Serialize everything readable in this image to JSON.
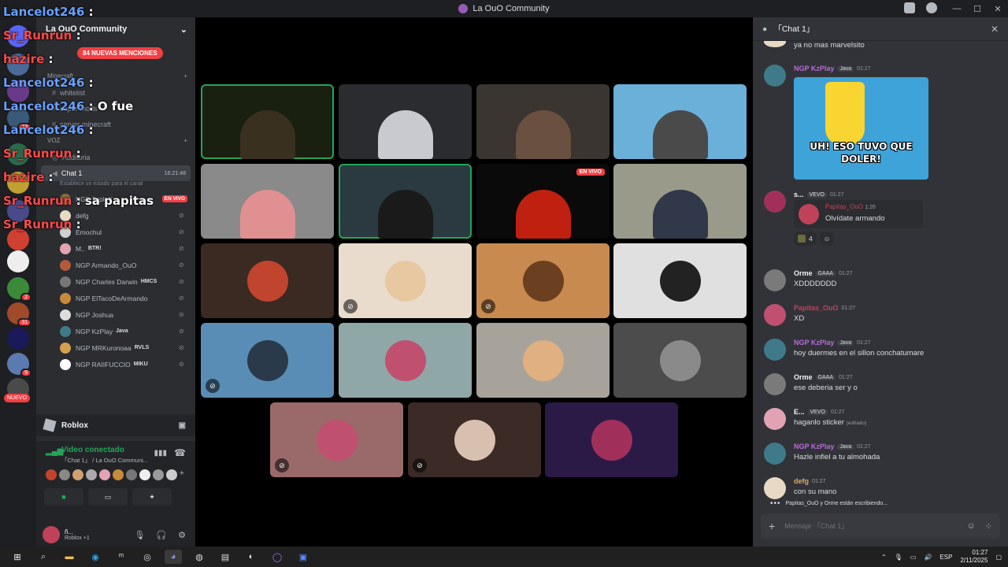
{
  "window": {
    "title": "La OuO Community",
    "minimize": "—",
    "maximize": "☐",
    "close": "✕"
  },
  "rail": {
    "nuevo_label": "NUEVO",
    "badges": [
      "73",
      "2",
      "31",
      "9"
    ]
  },
  "sidebar": {
    "guild_name": "La OuO Community",
    "mentions_pill": "84 NUEVAS MENCIONES",
    "categories": [
      "Minecraft",
      "VOZ"
    ],
    "channels": [
      "whitelist",
      "super-mods",
      "server-minecraft",
      "Auditoria",
      "Chat 1"
    ],
    "voice_status": "Establece un estado para el canal",
    "voice_timer": "16:21:48",
    "members": [
      {
        "name": "NGP TripleX",
        "tag": "",
        "live": "EN VIVO",
        "color": "#8a6d3b"
      },
      {
        "name": "defg",
        "tag": "",
        "color": "#e7d9c4"
      },
      {
        "name": "Emochul",
        "tag": "",
        "color": "#cfcfcf"
      },
      {
        "name": "M..",
        "tag": "BTR!",
        "color": "#e1a3b3"
      },
      {
        "name": "NGP Armando_OuO",
        "tag": "",
        "color": "#b25a3a"
      },
      {
        "name": "NGP Charles Darwin",
        "tag": "HMCS",
        "color": "#777777"
      },
      {
        "name": "NGP ElTacoDeArmando",
        "tag": "",
        "color": "#c68a3a"
      },
      {
        "name": "NGP Joshua",
        "tag": "",
        "color": "#dddddd"
      },
      {
        "name": "NGP KzPlay",
        "tag": "Java",
        "color": "#3e7a8a"
      },
      {
        "name": "NGP MRKuronoaa",
        "tag": "RVLS",
        "color": "#d4a050"
      },
      {
        "name": "NGP RAIIFUCCIO",
        "tag": "MIKU",
        "color": "#ffffff"
      }
    ],
    "roblox_label": "Roblox",
    "voice_panel": {
      "title": "Video conectado",
      "subtitle": "「Chat 1」 / La OuO Communi..."
    },
    "user": {
      "name": "ñ...",
      "status": "Roblox +1"
    }
  },
  "overlay": [
    {
      "name": "Lancelot246",
      "text": ":",
      "color": "#6aa0ff"
    },
    {
      "name": "Sr_Runrun",
      "text": ":",
      "color": "#ff4a4a"
    },
    {
      "name": "hazire",
      "text": ":",
      "color": "#ff4a4a"
    },
    {
      "name": "Lancelot246",
      "text": ":",
      "color": "#6aa0ff"
    },
    {
      "name": "Lancelot246",
      "text": ": O fue",
      "color": "#6aa0ff"
    },
    {
      "name": "Lancelot246",
      "text": ":",
      "color": "#6aa0ff"
    },
    {
      "name": "Sr_Runrun",
      "text": ":",
      "color": "#ff4a4a"
    },
    {
      "name": "hazire",
      "text": ":",
      "color": "#ff4a4a"
    },
    {
      "name": "Sr_Runrun",
      "text": ": sa papitas",
      "color": "#ff4a4a"
    },
    {
      "name": "Sr_Runrun",
      "text": ":",
      "color": "#ff4a4a"
    }
  ],
  "stage": {
    "live_label": "EN VIVO",
    "tiles": [
      {
        "kind": "video",
        "bg": "#1a2010",
        "fg": "#3a3020",
        "speaking": true
      },
      {
        "kind": "video",
        "bg": "#2a2c30",
        "fg": "#c8cad0",
        "speaking": false
      },
      {
        "kind": "video",
        "bg": "#3a3530",
        "fg": "#6a5040",
        "speaking": false
      },
      {
        "kind": "video",
        "bg": "#6ab0d8",
        "fg": "#4a4a4a",
        "speaking": false
      },
      {
        "kind": "video",
        "bg": "#8a8a8a",
        "fg": "#e09090",
        "speaking": false
      },
      {
        "kind": "video",
        "bg": "#2a3a40",
        "fg": "#1a1a1a",
        "speaking": true
      },
      {
        "kind": "video",
        "bg": "#0a0a0a",
        "fg": "#c02010",
        "speaking": false,
        "live": true
      },
      {
        "kind": "video",
        "bg": "#9a9a8a",
        "fg": "#30384a",
        "speaking": false
      },
      {
        "kind": "avatar",
        "bg": "#3a2a22",
        "fg": "#c0442e",
        "mute": false
      },
      {
        "kind": "avatar",
        "bg": "#e9dccd",
        "fg": "#e8c8a0",
        "mute": true
      },
      {
        "kind": "avatar",
        "bg": "#c98a4f",
        "fg": "#6a4020",
        "mute": true
      },
      {
        "kind": "avatar",
        "bg": "#e0e0e0",
        "fg": "#222222",
        "mute": false
      },
      {
        "kind": "avatar",
        "bg": "#5a8db5",
        "fg": "#2a3a4a",
        "mute": true
      },
      {
        "kind": "avatar",
        "bg": "#8fa7a6",
        "fg": "#c05070",
        "mute": false
      },
      {
        "kind": "avatar",
        "bg": "#a7a39a",
        "fg": "#e0b080",
        "mute": false
      },
      {
        "kind": "avatar",
        "bg": "#4c4c4c",
        "fg": "#8a8a8a",
        "mute": false
      },
      {
        "kind": "avatar",
        "bg": "#9a6a6a",
        "fg": "#c05070",
        "mute": true
      },
      {
        "kind": "avatar",
        "bg": "#3b2a26",
        "fg": "#d8c0b0",
        "mute": true
      },
      {
        "kind": "avatar",
        "bg": "#2c1a46",
        "fg": "#a0305a",
        "mute": false
      }
    ]
  },
  "chat": {
    "channel": "「Chat 1」",
    "typing": "Papitas_OuO y Orme están escribiendo...",
    "placeholder": "Mensaje 「Chat 1」",
    "messages": [
      {
        "name": "",
        "tag": "",
        "time": "",
        "text": "ya no mas marvelsito",
        "color": "#dbdee1",
        "av": "#e7d9c4"
      },
      {
        "name": "NGP KzPlay",
        "tag": "Java",
        "time": "01:27",
        "text": "",
        "color": "#b86bd6",
        "av": "#3e7a8a",
        "meme": "UH! ESO TUVO QUE DOLER!"
      },
      {
        "name": "s...",
        "tag": "VEVO",
        "time": "01:27",
        "text": "",
        "color": "#f2f3f5",
        "av": "#a0305a",
        "reply_name": "Papitas_OuO",
        "reply_time": "1:26",
        "reply_text": "Olvídate armando",
        "reaction_count": "4"
      },
      {
        "name": "Orme",
        "tag": "GAAA",
        "time": "01:27",
        "text": "XDDDDDDD",
        "color": "#f2f3f5",
        "av": "#7a7a7a"
      },
      {
        "name": "Papitas_OuO",
        "tag": "",
        "time": "01:27",
        "text": "XD",
        "color": "#c0425a",
        "av": "#c05070"
      },
      {
        "name": "NGP KzPlay",
        "tag": "Java",
        "time": "01:27",
        "text": "hoy duermes en el sillon conchatumare",
        "color": "#b86bd6",
        "av": "#3e7a8a"
      },
      {
        "name": "Orme",
        "tag": "GAAA",
        "time": "01:27",
        "text": "ese deberia ser y o",
        "color": "#f2f3f5",
        "av": "#7a7a7a"
      },
      {
        "name": "E...",
        "tag": "VEVO",
        "time": "01:27",
        "text": "haganlo sticker",
        "edited": "(editado)",
        "color": "#f2f3f5",
        "av": "#e1a3b3"
      },
      {
        "name": "NGP KzPlay",
        "tag": "Java",
        "time": "01:27",
        "text": "Hazle infiel a tu almohada",
        "color": "#b86bd6",
        "av": "#3e7a8a"
      },
      {
        "name": "defg",
        "tag": "",
        "time": "01:27",
        "text": "con su mano",
        "color": "#e0a86a",
        "av": "#e7d9c4"
      }
    ]
  },
  "taskbar": {
    "lang": "ESP",
    "time": "01:27",
    "date": "2/11/2025"
  }
}
